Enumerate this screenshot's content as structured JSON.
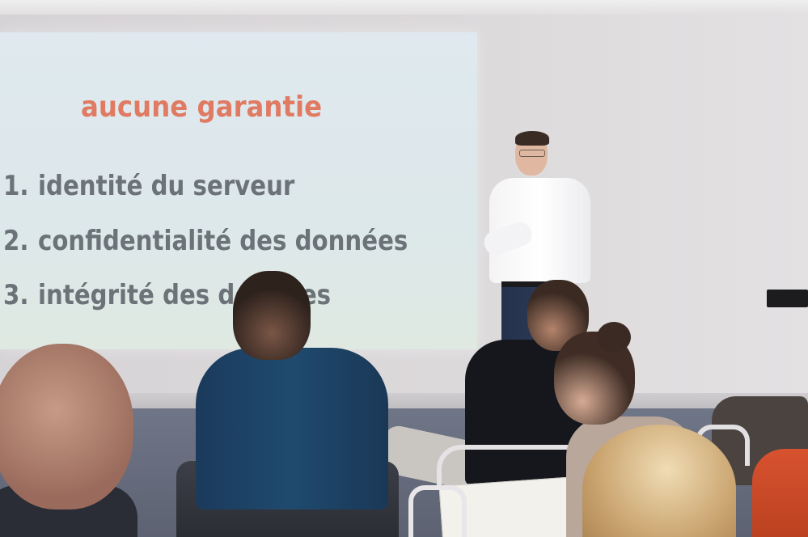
{
  "slide": {
    "title": "aucune garantie",
    "items": [
      {
        "number": "1.",
        "text": "identité du serveur"
      },
      {
        "number": "2.",
        "text": "confidentialité des données"
      },
      {
        "number": "3.",
        "text": "intégrité des données"
      }
    ]
  },
  "colors": {
    "title": "#e07a63",
    "item_text": "#6c7378",
    "slide_background": "#dfe9ee",
    "wall": "#d9d6d8"
  }
}
